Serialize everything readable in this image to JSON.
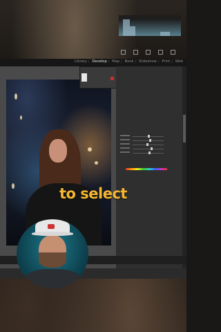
{
  "modules": [
    "Library",
    "Develop",
    "Map",
    "Book",
    "Slideshow",
    "Print",
    "Web"
  ],
  "active_module": "Develop",
  "caption": "to select",
  "colors": {
    "caption": "#f5b632",
    "accent_red": "#c83030"
  }
}
